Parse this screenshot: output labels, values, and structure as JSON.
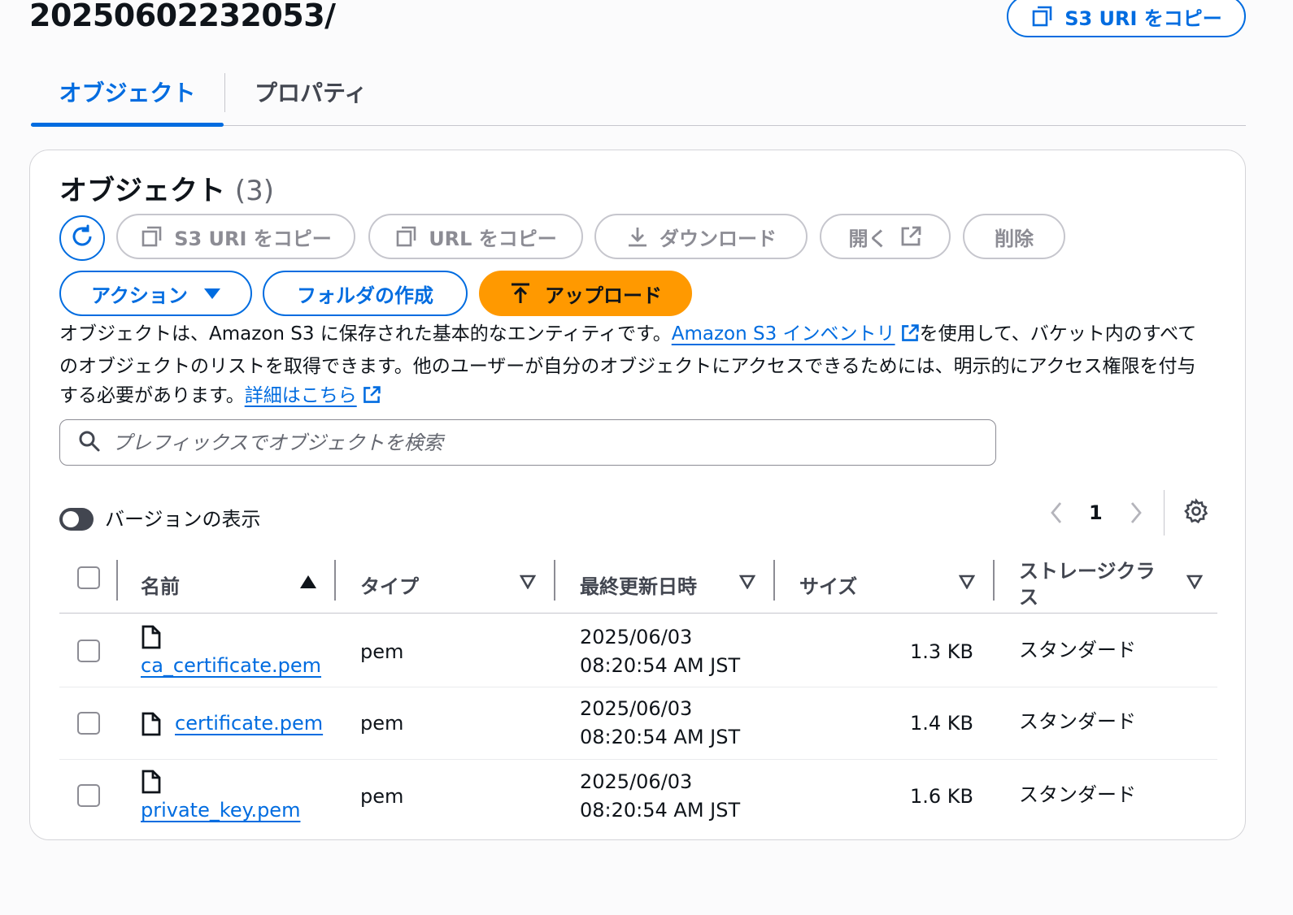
{
  "page": {
    "title": "20250602232053/",
    "copy_s3_uri_label": "S3 URI をコピー"
  },
  "tabs": [
    {
      "label": "オブジェクト",
      "active": true
    },
    {
      "label": "プロパティ",
      "active": false
    }
  ],
  "objects_panel": {
    "heading": "オブジェクト",
    "count": "(3)",
    "toolbar": {
      "copy_s3_uri": "S3 URI をコピー",
      "copy_url": "URL をコピー",
      "download": "ダウンロード",
      "open": "開く",
      "delete": "削除",
      "actions": "アクション",
      "create_folder": "フォルダの作成",
      "upload": "アップロード"
    },
    "description": {
      "part1": "オブジェクトは、Amazon S3 に保存された基本的なエンティティです。",
      "inventory_link": "Amazon S3 インベントリ",
      "part2": "を使用して、バケット内のすべてのオブジェクトのリストを取得できます。他のユーザーが自分のオブジェクトにアクセスできるためには、明示的にアクセス権限を付与する必要があります。",
      "learn_more_link": "詳細はこちら"
    },
    "search": {
      "placeholder": "プレフィックスでオブジェクトを検索",
      "value": ""
    },
    "show_versions_label": "バージョンの表示",
    "pagination": {
      "current_page": "1"
    },
    "columns": {
      "name": "名前",
      "type": "タイプ",
      "last_modified": "最終更新日時",
      "size": "サイズ",
      "storage_class": "ストレージクラス"
    },
    "rows": [
      {
        "name": "ca_certificate.pem",
        "type": "pem",
        "date": "2025/06/03",
        "time": "08:20:54 AM JST",
        "size": "1.3 KB",
        "storage_class": "スタンダード"
      },
      {
        "name": "certificate.pem",
        "type": "pem",
        "date": "2025/06/03",
        "time": "08:20:54 AM JST",
        "size": "1.4 KB",
        "storage_class": "スタンダード"
      },
      {
        "name": "private_key.pem",
        "type": "pem",
        "date": "2025/06/03",
        "time": "08:20:54 AM JST",
        "size": "1.6 KB",
        "storage_class": "スタンダード"
      }
    ]
  },
  "colors": {
    "primary": "#006ce0",
    "upload": "#ff9900",
    "disabled": "#8c8c94"
  }
}
